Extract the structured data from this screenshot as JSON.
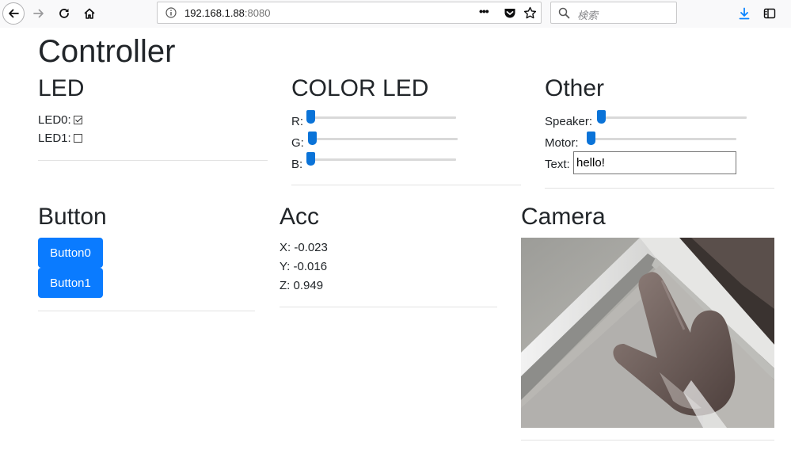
{
  "browser": {
    "url_host": "192.168.1.88",
    "url_port": ":8080",
    "search_placeholder": "検索",
    "page_actions_glyph": "•••"
  },
  "page": {
    "title": "Controller",
    "led": {
      "heading": "LED",
      "items": [
        {
          "label": "LED0:",
          "checked": true
        },
        {
          "label": "LED1:",
          "checked": false
        }
      ]
    },
    "color_led": {
      "heading": "COLOR LED",
      "sliders": [
        {
          "label": "R:",
          "value": 0
        },
        {
          "label": "G:",
          "value": 0
        },
        {
          "label": "B:",
          "value": 0
        }
      ]
    },
    "other": {
      "heading": "Other",
      "speaker_label": "Speaker:",
      "speaker_value": 0,
      "motor_label": "Motor:",
      "motor_value": 0,
      "text_label": "Text:",
      "text_value": "hello!"
    },
    "button": {
      "heading": "Button",
      "buttons": [
        "Button0",
        "Button1"
      ]
    },
    "acc": {
      "heading": "Acc",
      "x": "X: -0.023",
      "y": "Y: -0.016",
      "z": "Z: 0.949"
    },
    "camera": {
      "heading": "Camera"
    }
  },
  "colors": {
    "accent": "#0a7bff",
    "slider_thumb": "#0a73d8",
    "divider": "#e2e2e2"
  }
}
